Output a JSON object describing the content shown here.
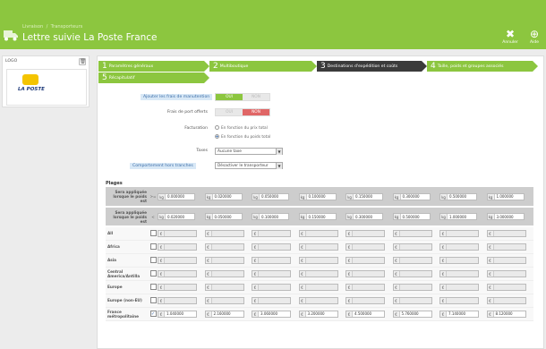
{
  "header": {
    "crumb1": "Livraison",
    "crumb2": "Transporteurs",
    "title": "Lettre suivie La Poste France",
    "btn_close": "Annuler",
    "btn_help": "Aide"
  },
  "logo": {
    "title": "LOGO",
    "brand": "LA POSTE"
  },
  "steps": [
    {
      "num": "1",
      "label": "Paramètres généraux"
    },
    {
      "num": "2",
      "label": "Multiboutique"
    },
    {
      "num": "3",
      "label": "Destinations d'expédition et coûts"
    },
    {
      "num": "4",
      "label": "Taille, poids et groupes associés"
    },
    {
      "num": "5",
      "label": "Récapitulatif"
    }
  ],
  "form": {
    "handling_label": "Ajouter les frais de manutention",
    "handling_yes": "OUI",
    "handling_no": "NON",
    "freeship_label": "Frais de port offerts",
    "freeship_yes": "OUI",
    "freeship_no": "NON",
    "billing_label": "Facturation",
    "billing_opt1": "En fonction du prix total",
    "billing_opt2": "En fonction du poids total",
    "tax_label": "Taxes",
    "tax_value": "Aucune taxe",
    "oor_label": "Comportement hors tranches",
    "oor_value": "Désactiver le transporteur"
  },
  "grid": {
    "title": "Plages",
    "row1_label": "Sera appliquée lorsque le poids est",
    "row1_op": ">=",
    "row2_label": "Sera appliquée lorsque le poids est",
    "row2_op": "<",
    "unit": "kg",
    "currency": "€",
    "from": [
      "0.000000",
      "0.020000",
      "0.050000",
      "0.100000",
      "0.150000",
      "0.300000",
      "0.500000",
      "1.000000"
    ],
    "to": [
      "0.020000",
      "0.050000",
      "0.100000",
      "0.150000",
      "0.300000",
      "0.500000",
      "1.000000",
      "3.000000"
    ],
    "zones": [
      {
        "name": "All",
        "checked": false,
        "values": [
          "",
          "",
          "",
          "",
          "",
          "",
          "",
          ""
        ]
      },
      {
        "name": "Africa",
        "checked": false,
        "values": [
          "",
          "",
          "",
          "",
          "",
          "",
          "",
          ""
        ]
      },
      {
        "name": "Asia",
        "checked": false,
        "values": [
          "",
          "",
          "",
          "",
          "",
          "",
          "",
          ""
        ]
      },
      {
        "name": "Central America/Antilla",
        "checked": false,
        "values": [
          "",
          "",
          "",
          "",
          "",
          "",
          "",
          ""
        ]
      },
      {
        "name": "Europe",
        "checked": false,
        "values": [
          "",
          "",
          "",
          "",
          "",
          "",
          "",
          ""
        ]
      },
      {
        "name": "Europe (non-EU)",
        "checked": false,
        "values": [
          "",
          "",
          "",
          "",
          "",
          "",
          "",
          ""
        ]
      },
      {
        "name": "France métropolitaine",
        "checked": true,
        "values": [
          "1.040000",
          "2.160000",
          "3.060000",
          "3.200000",
          "4.500000",
          "5.760000",
          "7.140000",
          "8.120000"
        ]
      }
    ]
  }
}
